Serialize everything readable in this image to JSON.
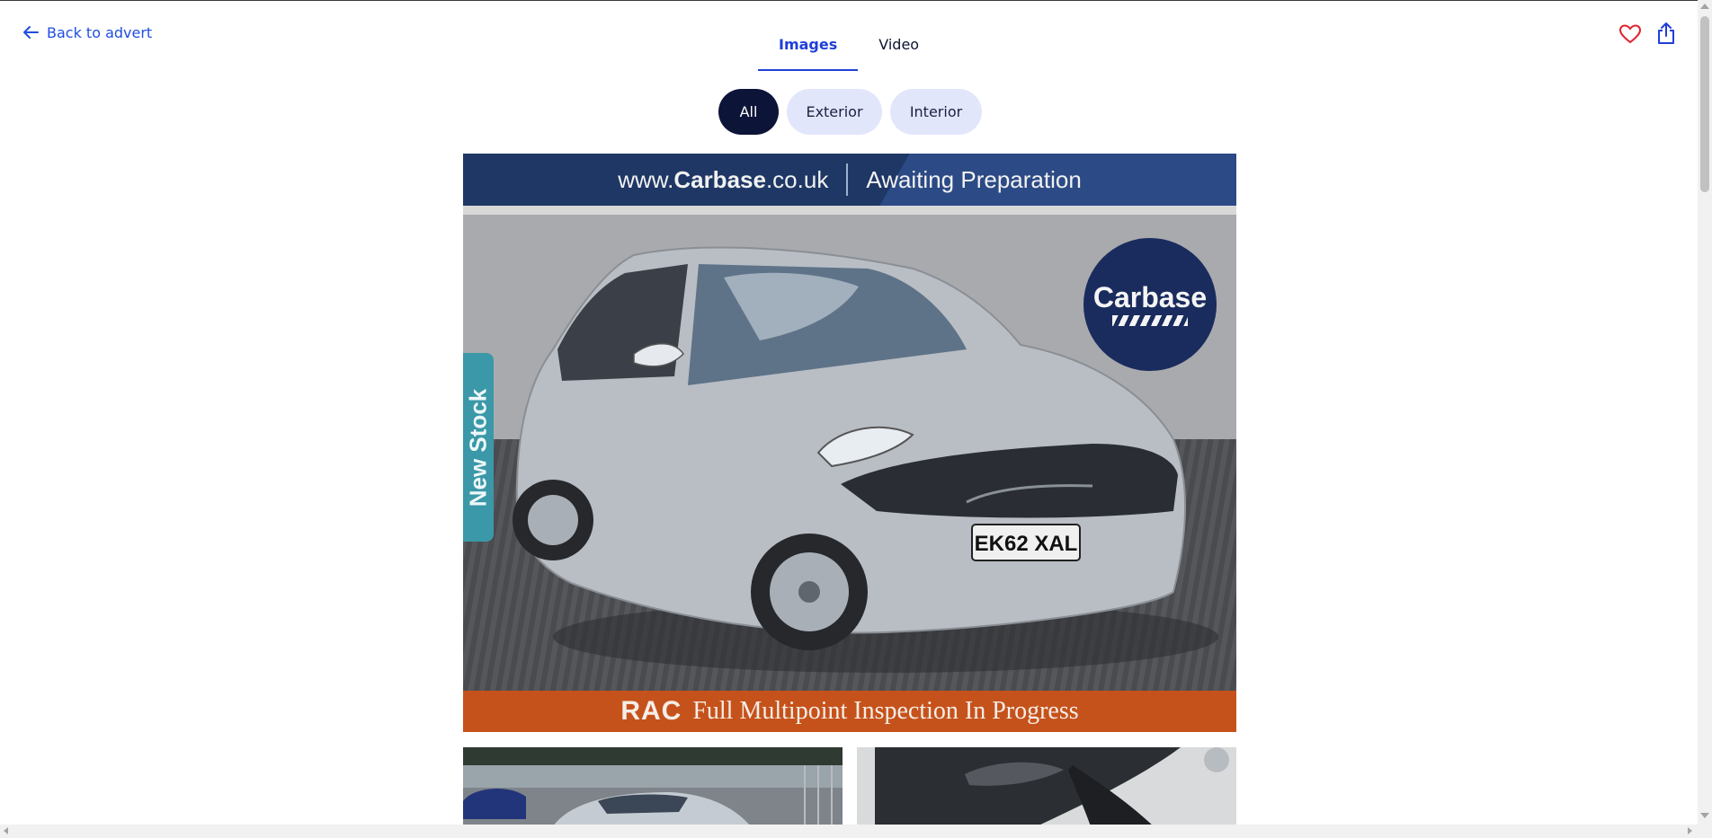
{
  "header": {
    "back_label": "Back to advert",
    "tabs": [
      {
        "label": "Images",
        "active": true
      },
      {
        "label": "Video",
        "active": false
      }
    ],
    "favourite_icon": "heart-icon",
    "share_icon": "share-icon"
  },
  "filters": [
    {
      "label": "All",
      "selected": true
    },
    {
      "label": "Exterior",
      "selected": false
    },
    {
      "label": "Interior",
      "selected": false
    }
  ],
  "main_image": {
    "banner_site": "www.",
    "banner_site_bold": "Carbase",
    "banner_site_suffix": ".co.uk",
    "banner_status": "Awaiting Preparation",
    "side_tag": "New Stock",
    "badge": "Carbase",
    "plate": "EK62 XAL",
    "bottom_logo": "RAC",
    "bottom_text": "Full Multipoint Inspection In Progress"
  },
  "colors": {
    "accent": "#1f3fd8",
    "selected_pill": "#0c1438",
    "pill": "#e2e6fb",
    "favourite": "#e0242f"
  }
}
